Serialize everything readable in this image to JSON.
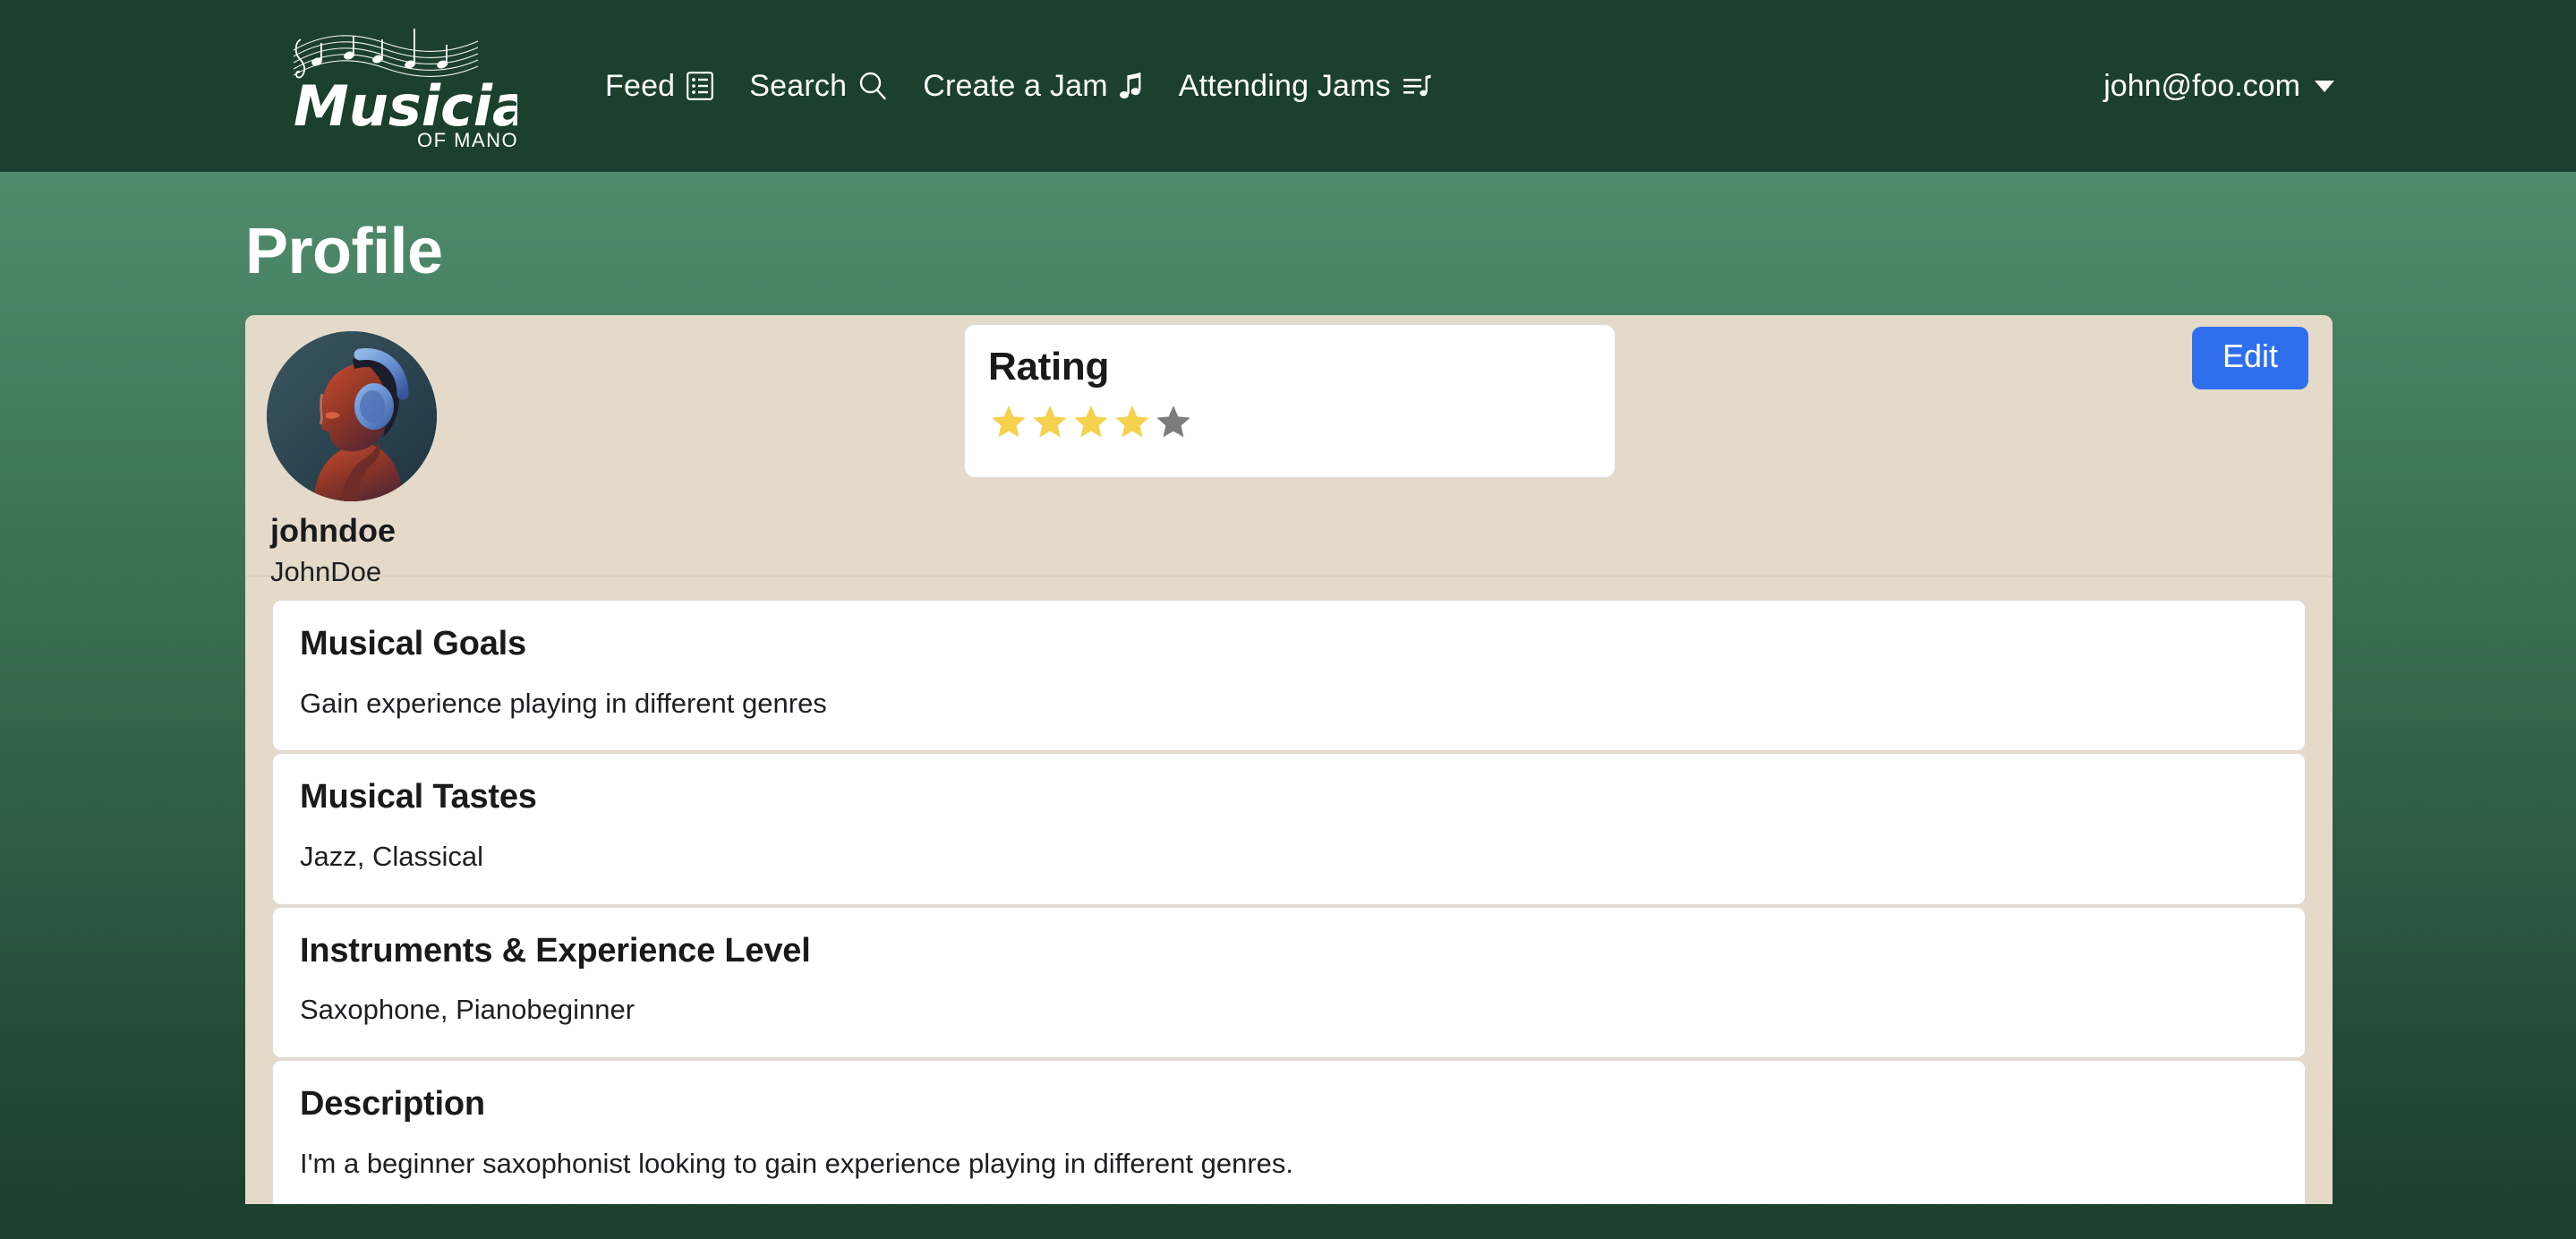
{
  "colors": {
    "nav_bg": "#1B402D",
    "bg_top": "#5A9476",
    "bg_bottom": "#1B402D",
    "card_bg": "#E5DACA",
    "accent_button": "#2F6FED",
    "star_filled": "#F5D14E",
    "star_empty": "#7C7C7C"
  },
  "navbar": {
    "brand": {
      "name": "Musicians",
      "subtitle": "OF MANOA",
      "icon": "music-staff-notes-icon"
    },
    "links": [
      {
        "label": "Feed",
        "icon": "list-feed-icon"
      },
      {
        "label": "Search",
        "icon": "search-icon"
      },
      {
        "label": "Create a Jam",
        "icon": "music-note-icon"
      },
      {
        "label": "Attending Jams",
        "icon": "playlist-note-icon"
      }
    ],
    "user": {
      "email": "john@foo.com",
      "caret": "chevron-down-icon"
    }
  },
  "page": {
    "title": "Profile"
  },
  "profile": {
    "avatar_alt": "person-with-headphones-photo",
    "username": "johndoe",
    "display_name": "JohnDoe",
    "edit_label": "Edit",
    "rating": {
      "title": "Rating",
      "value": 4,
      "max": 5
    },
    "sections": [
      {
        "title": "Musical Goals",
        "body": "Gain experience playing in different genres"
      },
      {
        "title": "Musical Tastes",
        "body": "Jazz, Classical"
      },
      {
        "title": "Instruments & Experience Level",
        "body": "Saxophone, Pianobeginner"
      },
      {
        "title": "Description",
        "body": "I'm a beginner saxophonist looking to gain experience playing in different genres."
      }
    ]
  }
}
